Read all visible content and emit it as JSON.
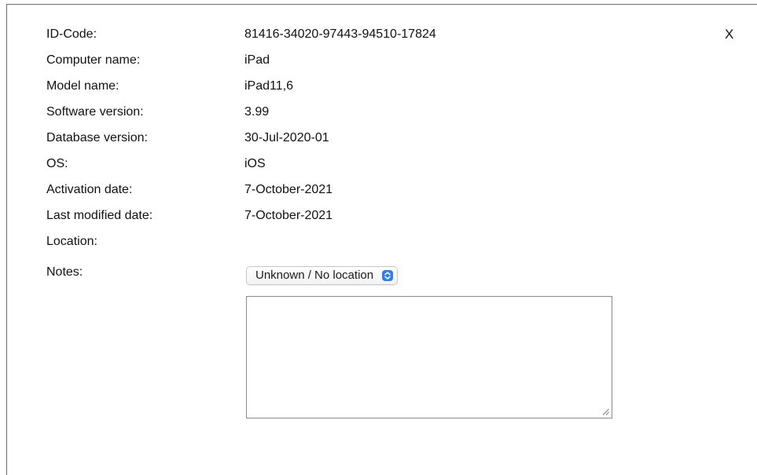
{
  "dialog": {
    "close_label": "X"
  },
  "info": {
    "id_code": {
      "label": "ID-Code:",
      "value": "81416-34020-97443-94510-17824"
    },
    "computer_name": {
      "label": "Computer name:",
      "value": "iPad"
    },
    "model_name": {
      "label": "Model name:",
      "value": "iPad11,6"
    },
    "software_version": {
      "label": "Software version:",
      "value": "3.99"
    },
    "database_version": {
      "label": "Database version:",
      "value": "30-Jul-2020-01"
    },
    "os": {
      "label": "OS:",
      "value": "iOS"
    },
    "activation_date": {
      "label": "Activation date:",
      "value": "7-October-2021"
    },
    "last_modified_date": {
      "label": "Last modified date:",
      "value": "7-October-2021"
    }
  },
  "location": {
    "label": "Location:",
    "selected": "Unknown / No location",
    "accent_color": "#2f7df6"
  },
  "notes": {
    "label": "Notes:",
    "value": ""
  }
}
